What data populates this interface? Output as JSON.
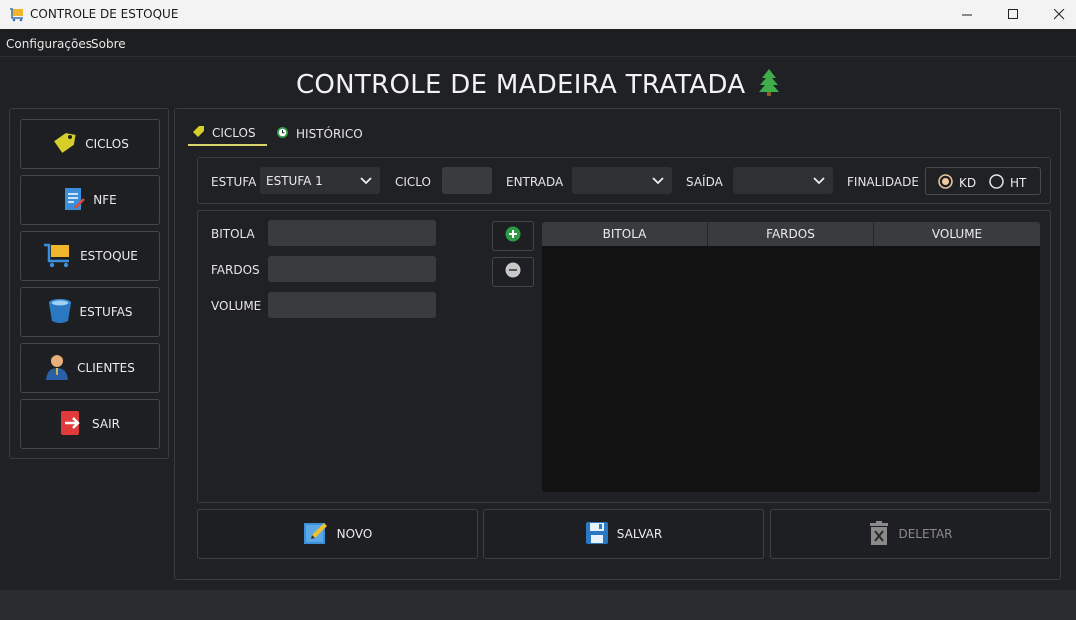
{
  "window": {
    "title": "CONTROLE DE ESTOQUE",
    "controls": [
      "minimize-icon",
      "maximize-icon",
      "close-icon"
    ]
  },
  "menu": {
    "items": [
      "Configurações",
      "Sobre"
    ]
  },
  "app_title": "CONTROLE DE MADEIRA TRATADA",
  "sidebar": {
    "items": [
      {
        "label": "CICLOS",
        "icon": "tag-icon"
      },
      {
        "label": "NFE",
        "icon": "invoice-icon"
      },
      {
        "label": "ESTOQUE",
        "icon": "cart-icon"
      },
      {
        "label": "ESTUFAS",
        "icon": "bucket-icon"
      },
      {
        "label": "CLIENTES",
        "icon": "user-icon"
      },
      {
        "label": "SAIR",
        "icon": "exit-icon"
      }
    ]
  },
  "tabs": [
    {
      "label": "CICLOS",
      "icon": "tag-icon",
      "active": true
    },
    {
      "label": "HISTÓRICO",
      "icon": "clock-icon",
      "active": false
    }
  ],
  "filters": {
    "estufa_label": "ESTUFA",
    "estufa_value": "ESTUFA 1",
    "ciclo_label": "CICLO",
    "ciclo_value": "",
    "entrada_label": "ENTRADA",
    "entrada_value": "",
    "saida_label": "SAÍDA",
    "saida_value": "",
    "finalidade_label": "FINALIDADE",
    "finalidade_options": [
      "KD",
      "HT"
    ],
    "finalidade_selected": "KD"
  },
  "form": {
    "bitola_label": "BITOLA",
    "bitola_value": "",
    "fardos_label": "FARDOS",
    "fardos_value": "",
    "volume_label": "VOLUME",
    "volume_value": ""
  },
  "table": {
    "columns": [
      "BITOLA",
      "FARDOS",
      "VOLUME"
    ],
    "rows": []
  },
  "actions": {
    "novo": "NOVO",
    "salvar": "SALVAR",
    "deletar": "DELETAR",
    "deletar_enabled": false
  },
  "colors": {
    "background": "#202124",
    "accent_tab": "#d8d36a",
    "add_green": "#2e9a45",
    "table_bg": "#121212"
  }
}
